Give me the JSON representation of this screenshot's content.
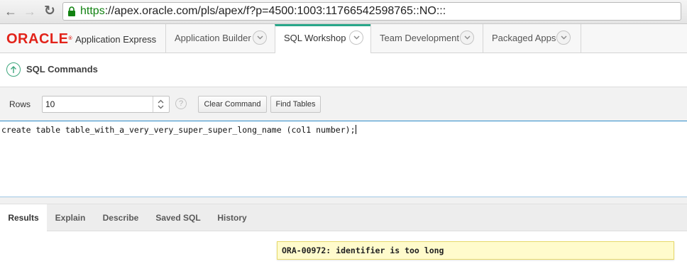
{
  "browser": {
    "url_scheme": "https",
    "url_rest": "://apex.oracle.com/pls/apex/f?p=4500:1003:11766542598765::NO:::",
    "back_icon": "back-arrow-icon",
    "forward_icon": "forward-arrow-icon",
    "reload_icon": "reload-icon",
    "lock_icon": "lock-icon",
    "secure_color": "#128212"
  },
  "header": {
    "brand": "ORACLE",
    "product": "Application Express",
    "brand_color": "#e2231a",
    "tabs": [
      {
        "label": "Application Builder",
        "active": false
      },
      {
        "label": "SQL Workshop",
        "active": true
      },
      {
        "label": "Team Development",
        "active": false
      },
      {
        "label": "Packaged Apps",
        "active": false
      }
    ],
    "active_accent": "#2aa78a"
  },
  "breadcrumb": {
    "title": "SQL Commands",
    "icon": "up-arrow-icon"
  },
  "toolbar": {
    "rows_label": "Rows",
    "rows_value": "10",
    "help_glyph": "?",
    "clear_command": "Clear Command",
    "find_tables": "Find Tables"
  },
  "editor": {
    "text": "create table table_with_a_very_very_super_super_long_name (col1 number);"
  },
  "result_tabs": [
    {
      "label": "Results",
      "active": true
    },
    {
      "label": "Explain",
      "active": false
    },
    {
      "label": "Describe",
      "active": false
    },
    {
      "label": "Saved SQL",
      "active": false
    },
    {
      "label": "History",
      "active": false
    }
  ],
  "results": {
    "error_message": "ORA-00972: identifier is too long"
  }
}
